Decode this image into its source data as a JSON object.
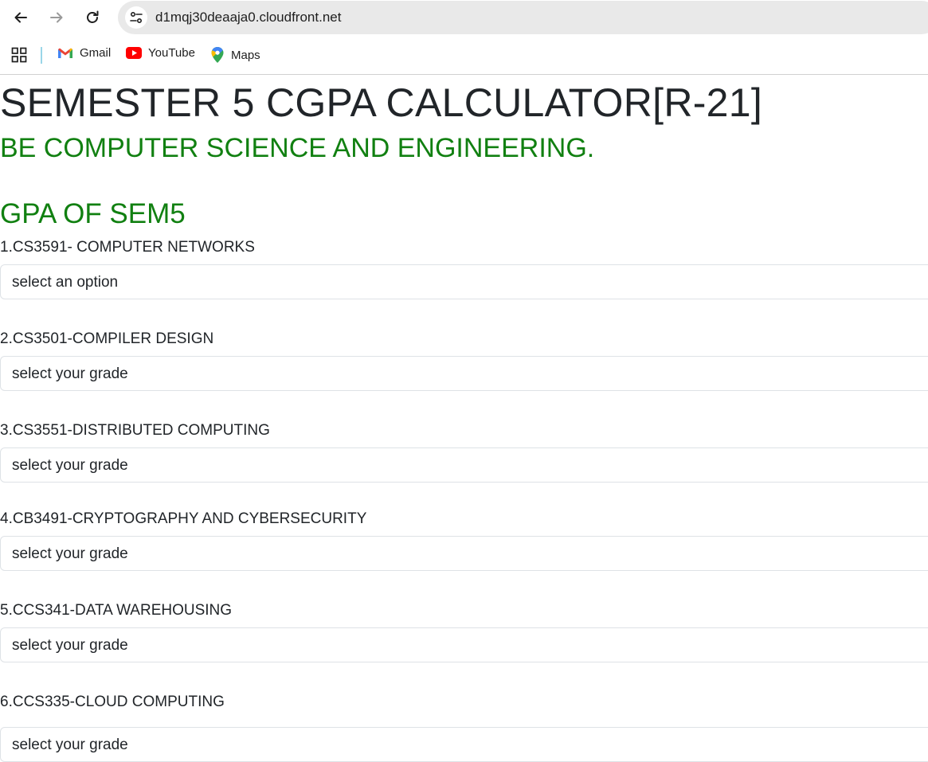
{
  "browser": {
    "url": "d1mqj30deaaja0.cloudfront.net",
    "bookmarks": [
      {
        "label": "Gmail",
        "icon": "gmail-icon"
      },
      {
        "label": "YouTube",
        "icon": "youtube-icon"
      },
      {
        "label": "Maps",
        "icon": "maps-icon"
      }
    ]
  },
  "page": {
    "title": "SEMESTER 5 CGPA CALCULATOR[R-21]",
    "subtitle": "BE COMPUTER SCIENCE AND ENGINEERING.",
    "section": "GPA OF SEM5",
    "courses": [
      {
        "label": "1.CS3591- COMPUTER NETWORKS",
        "placeholder": "select an option"
      },
      {
        "label": "2.CS3501-COMPILER DESIGN",
        "placeholder": "select your grade"
      },
      {
        "label": "3.CS3551-DISTRIBUTED COMPUTING",
        "placeholder": "select your grade"
      },
      {
        "label": "4.CB3491-CRYPTOGRAPHY AND CYBERSECURITY",
        "placeholder": "select your grade"
      },
      {
        "label": "5.CCS341-DATA WAREHOUSING",
        "placeholder": "select your grade"
      },
      {
        "label": "6.CCS335-CLOUD COMPUTING",
        "placeholder": "select your grade"
      }
    ]
  },
  "colors": {
    "accent_green": "#118011",
    "text": "#212529"
  }
}
